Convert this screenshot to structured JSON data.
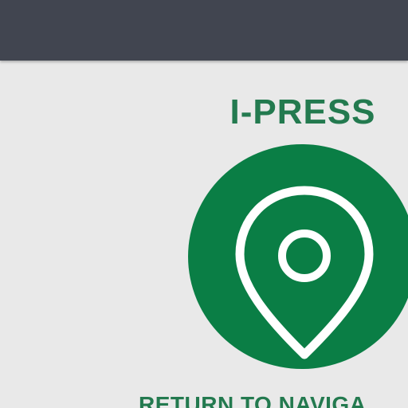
{
  "header": {
    "color": "#414550"
  },
  "main": {
    "title": "I-PRESS",
    "accent_color": "#0a7e45",
    "pin_icon": "location-pin-icon",
    "return_label": "RETURN TO NAVIGA"
  }
}
